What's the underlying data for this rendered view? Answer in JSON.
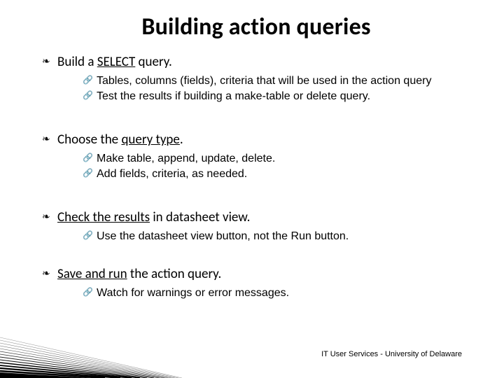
{
  "title": "Building action queries",
  "items": [
    {
      "lead_prefix": "Build a ",
      "lead_underline": "SELECT",
      "lead_suffix": " query.",
      "sub": [
        "Tables, columns (fields), criteria that will be used in the action query",
        "Test the results if building a make-table or delete query."
      ],
      "gap": "lg"
    },
    {
      "lead_prefix": "Choose the ",
      "lead_underline": "query type",
      "lead_suffix": ".",
      "sub": [
        "Make table, append, update, delete.",
        "Add fields, criteria, as needed."
      ],
      "gap": "lg"
    },
    {
      "lead_prefix": "",
      "lead_underline": "Check the results",
      "lead_suffix": " in datasheet view.",
      "sub": [
        "Use the datasheet view button, not the Run button."
      ],
      "gap": "md"
    },
    {
      "lead_prefix": "",
      "lead_underline": "Save and run",
      "lead_suffix": " the action query.",
      "sub": [
        "Watch for warnings or error messages."
      ],
      "gap": ""
    }
  ],
  "footer": "IT User Services - University of Delaware"
}
